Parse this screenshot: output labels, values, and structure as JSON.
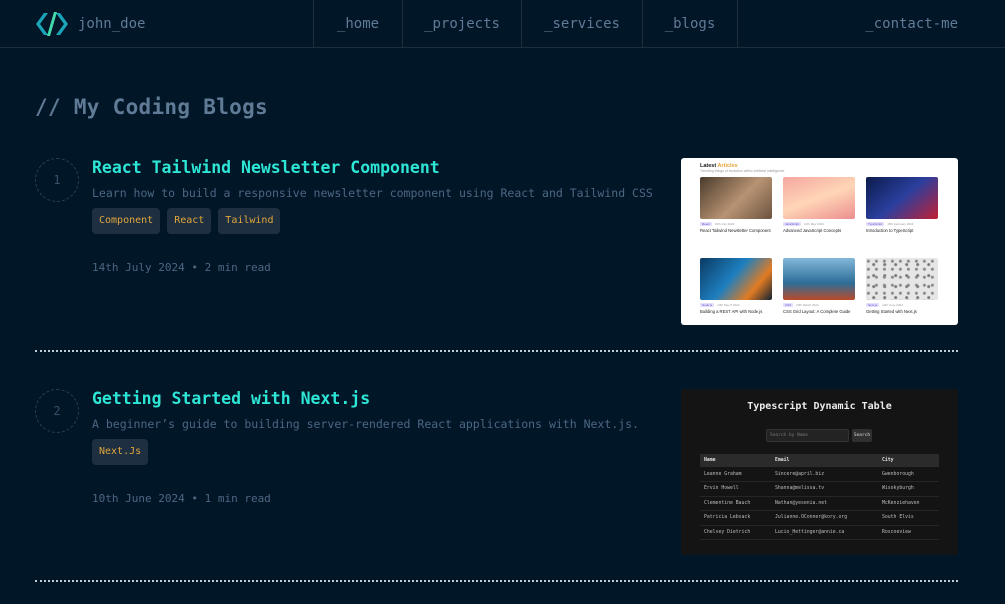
{
  "header": {
    "brand": "john_doe",
    "nav": [
      {
        "label": "_home"
      },
      {
        "label": "_projects"
      },
      {
        "label": "_services"
      },
      {
        "label": "_blogs"
      }
    ],
    "contact": "_contact-me"
  },
  "page": {
    "title": "// My Coding Blogs"
  },
  "colors": {
    "background": "#011627",
    "accent_title": "#2ee6d6",
    "tag_text": "#e1a73b",
    "tag_bg": "#1d2f40",
    "muted": "#607b96"
  },
  "blogs": [
    {
      "number": "1",
      "title": "React Tailwind Newsletter Component",
      "description": "Learn how to build a responsive newsletter component using React and Tailwind CSS",
      "tags": [
        "Component",
        "React",
        "Tailwind"
      ],
      "meta": "14th July 2024 • 2 min read",
      "thumbnail": {
        "heading_prefix": "Latest ",
        "heading_accent": "Articles",
        "subheading": "Trending things of evolution within Artificial Intelligence",
        "cards": [
          {
            "badge": "React",
            "date": "15th July 2024",
            "caption": "React Tailwind Newsletter Component"
          },
          {
            "badge": "JavaScript",
            "date": "10th May 2024",
            "caption": "Advanced JavaScript Concepts"
          },
          {
            "badge": "TypeScript",
            "date": "15th February 2024",
            "caption": "Introduction to TypeScript"
          },
          {
            "badge": "Node.js",
            "date": "10th May 8 2024",
            "caption": "Building a REST API with Node.js"
          },
          {
            "badge": "CSS",
            "date": "20th March 2024",
            "caption": "CSS Grid Layout: A Complete Guide"
          },
          {
            "badge": "Next.js",
            "date": "10th June 2024",
            "caption": "Getting Started with Next.js"
          }
        ]
      }
    },
    {
      "number": "2",
      "title": "Getting Started with Next.js",
      "description": "A beginner’s guide to building server-rendered React applications with Next.js.",
      "tags": [
        "Next.Js"
      ],
      "meta": "10th June 2024 • 1 min read",
      "thumbnail": {
        "title": "Typescript Dynamic Table",
        "search_placeholder": "Search by Name",
        "search_button": "Search",
        "columns": [
          "Name",
          "Email",
          "City"
        ],
        "rows": [
          [
            "Leanne Graham",
            "Sincere@april.biz",
            "Gwenborough"
          ],
          [
            "Ervin Howell",
            "Shanna@melissa.tv",
            "Wisokyburgh"
          ],
          [
            "Clementine Bauch",
            "Nathan@yesenia.net",
            "McKenziehaven"
          ],
          [
            "Patricia Lebsack",
            "Julianne.OConner@kory.org",
            "South Elvis"
          ],
          [
            "Chelsey Dietrich",
            "Lucio_Hettinger@annie.ca",
            "Roscoeview"
          ]
        ]
      }
    }
  ]
}
